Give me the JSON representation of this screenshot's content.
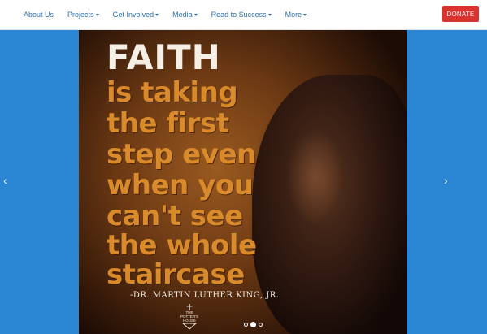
{
  "nav": {
    "items": [
      {
        "label": "About Us",
        "dropdown": false
      },
      {
        "label": "Projects",
        "dropdown": true
      },
      {
        "label": "Get Involved",
        "dropdown": true
      },
      {
        "label": "Media",
        "dropdown": true
      },
      {
        "label": "Read to Success",
        "dropdown": true
      },
      {
        "label": "More",
        "dropdown": true
      }
    ],
    "donate_label": "DONATE"
  },
  "colors": {
    "nav_link": "#2a6fb0",
    "donate_bg": "#d9322f",
    "carousel_bg": "#2a86d3",
    "quote_orange": "#d98a2a"
  },
  "slide": {
    "quote_heading": "FAITH",
    "quote_lines": [
      "is taking",
      "the first",
      "step even",
      "when you",
      "can't see",
      "the whole",
      "staircase"
    ],
    "attribution": "-DR. MARTIN LUTHER KING, JR.",
    "logo_text": [
      "THE",
      "POTTER'S",
      "HOUSE"
    ]
  },
  "carousel": {
    "prev_icon": "chevron-left-icon",
    "next_icon": "chevron-right-icon",
    "slide_count": 3,
    "active_index": 1
  }
}
